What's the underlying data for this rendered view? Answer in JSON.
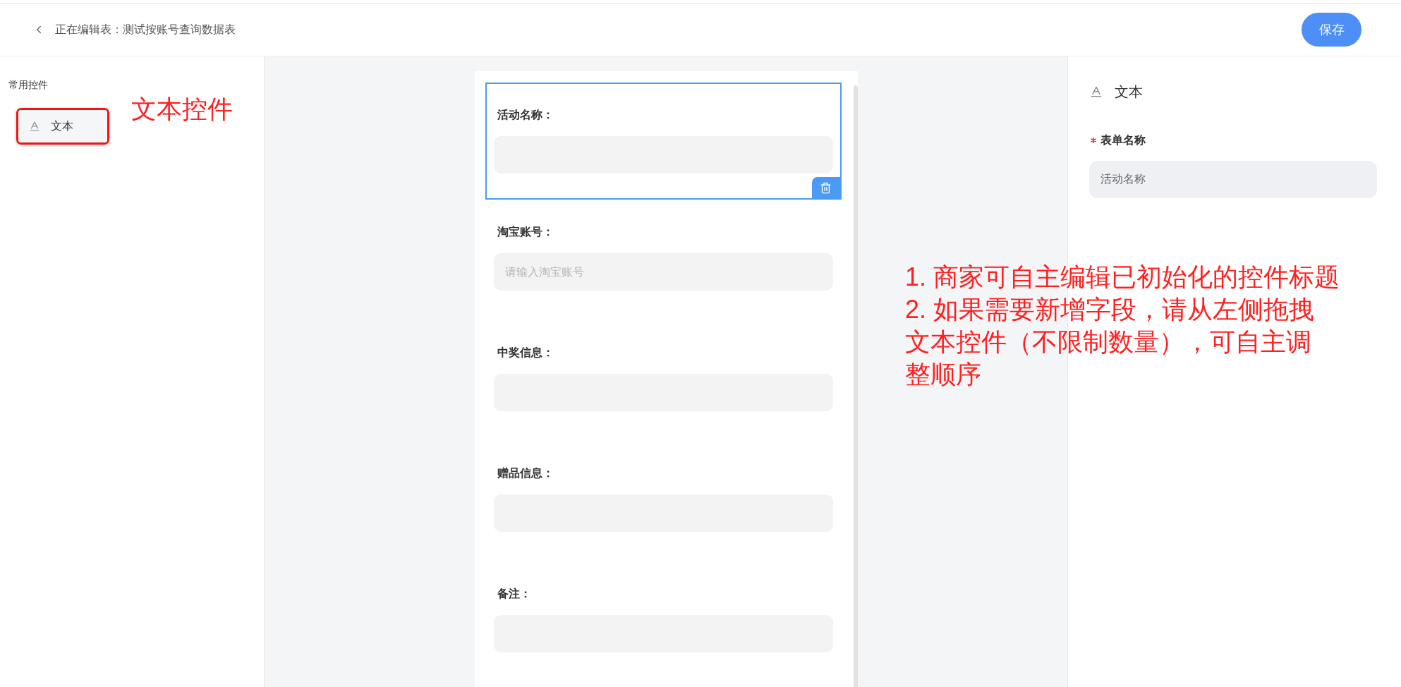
{
  "header": {
    "title": "正在编辑表：测试按账号查询数据表",
    "save_button": "保存"
  },
  "sidebar": {
    "section_title": "常用控件",
    "items": [
      {
        "label": "文本",
        "highlighted": true
      }
    ]
  },
  "annotations": {
    "sidebar_callout": "文本控件",
    "notes": [
      {
        "lines": [
          "1. 商家可自主编辑已初始化的控件标题"
        ]
      },
      {
        "lines": [
          "2. 如果需要新增字段，请从左侧拖拽",
          "文本控件（不限制数量），可自主调",
          "整顺序"
        ]
      }
    ]
  },
  "form": {
    "fields": [
      {
        "label": "活动名称：",
        "selected": true
      },
      {
        "label": "淘宝账号：",
        "placeholder": "请输入淘宝账号",
        "selected": false
      },
      {
        "label": "中奖信息：",
        "selected": false
      },
      {
        "label": "赠品信息：",
        "selected": false
      },
      {
        "label": "备注：",
        "selected": false
      }
    ]
  },
  "properties": {
    "control_type": "文本",
    "field_label": "表单名称",
    "required": true,
    "field_value": "活动名称"
  }
}
